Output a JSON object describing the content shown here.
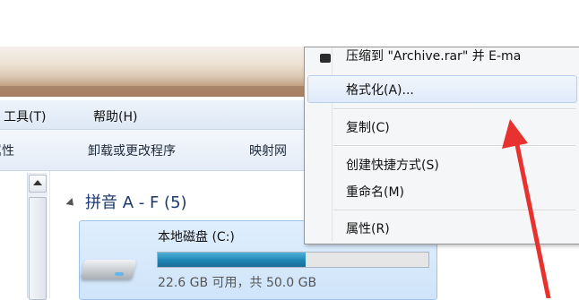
{
  "titlebar": {},
  "menubar": {
    "items": [
      {
        "label": "工具(T)"
      },
      {
        "label": "帮助(H)"
      }
    ]
  },
  "toolbar": {
    "items": [
      {
        "label": "属性"
      },
      {
        "label": "卸载或更改程序"
      },
      {
        "label": "映射网"
      }
    ]
  },
  "navigation": {
    "group_title": "拼音 A - F (5)"
  },
  "drive": {
    "name": "本地磁盘 (C:)",
    "size_text": "22.6 GB 可用，共 50.0 GB",
    "used_fraction": 0.548,
    "fill_color": "#1f86b4"
  },
  "context_menu": {
    "items": [
      {
        "label": "压缩到 \"Archive.rar\" 并 E-ma"
      },
      {
        "label": "格式化(A)..."
      },
      {
        "label": "复制(C)"
      },
      {
        "label": "创建快捷方式(S)"
      },
      {
        "label": "重命名(M)"
      },
      {
        "label": "属性(R)"
      }
    ]
  },
  "annotation": {
    "arrow_color": "#e8322f"
  }
}
